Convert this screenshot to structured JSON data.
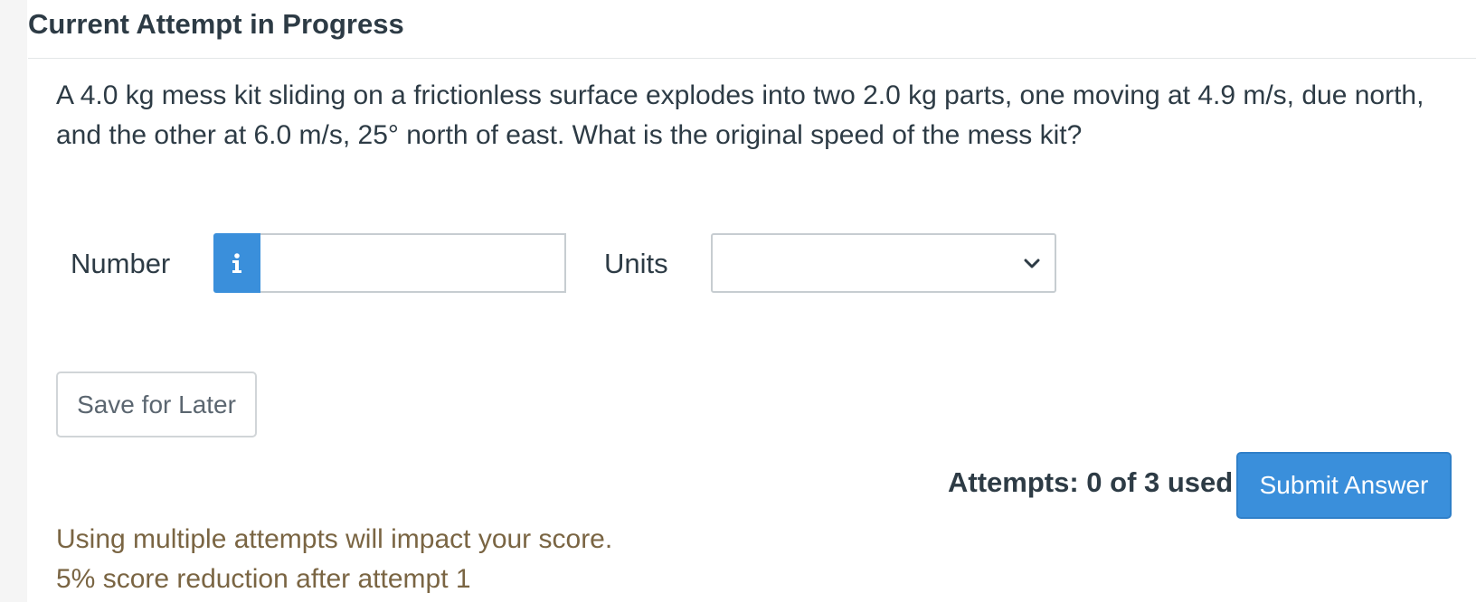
{
  "header": {
    "title": "Current Attempt in Progress"
  },
  "question": {
    "text": "A 4.0 kg mess kit sliding on a frictionless surface explodes into two 2.0 kg parts, one moving at 4.9 m/s, due north, and the other at 6.0 m/s, 25° north of east. What is the original speed of the mess kit?"
  },
  "answer": {
    "number_label": "Number",
    "info_icon": "info-icon",
    "number_value": "",
    "units_label": "Units",
    "units_selected": "",
    "units_icon": "chevron-down-icon"
  },
  "actions": {
    "save_label": "Save for Later",
    "attempts_text": "Attempts: 0 of 3 used",
    "submit_label": "Submit Answer"
  },
  "notice": {
    "line1": "Using multiple attempts will impact your score.",
    "line2": "5% score reduction after attempt 1"
  },
  "colors": {
    "primary": "#3a8fdb",
    "warning_text": "#7a6543",
    "text": "#2d3b45"
  }
}
